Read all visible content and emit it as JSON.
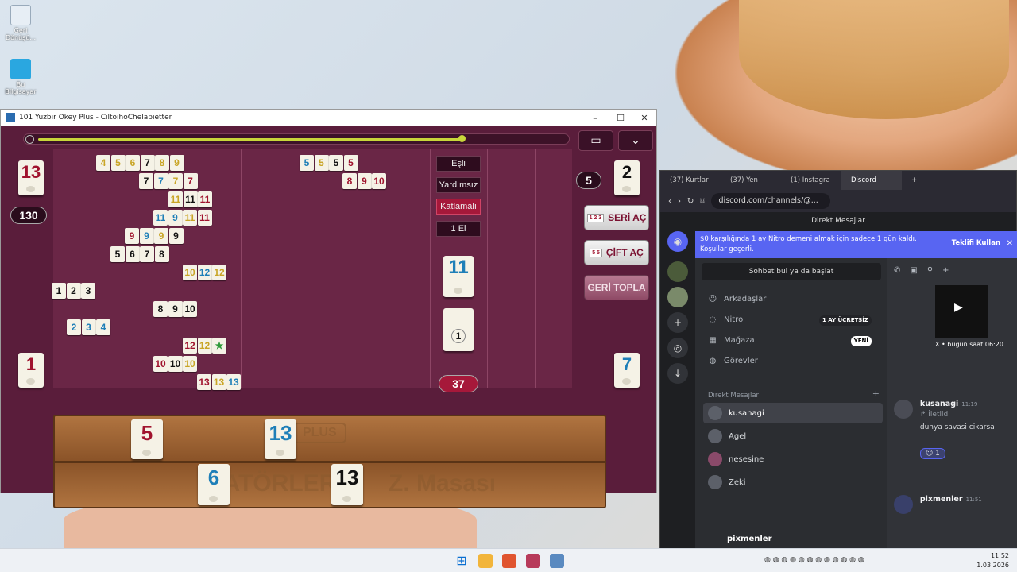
{
  "desktop": {
    "icons": [
      {
        "label": "Geri Dönüşü...",
        "icon": "recycle-bin-icon"
      },
      {
        "label": "Bu Bilgisayar",
        "icon": "computer-icon"
      }
    ]
  },
  "game_window": {
    "title": "101 Yüzbir Okey Plus - CiltoihoChelapietter",
    "controls": {
      "minimize": "–",
      "maximize": "☐",
      "close": "✕"
    },
    "timer_progress": 0.82,
    "chat_icon": "chat-bubble-icon",
    "menu_icon": "chevron-down-icon",
    "left_top_counter": "13",
    "left_score": "130",
    "left_bottom_counter": "1",
    "right_top_counter": "2",
    "right_badge": "5",
    "right_bottom_counter": "7",
    "options": [
      "Eşli",
      "Yardımsız",
      "Katlamalı",
      "1 El"
    ],
    "indicator_tile": "11",
    "deck_tile": "1",
    "deck_count": "37",
    "buttons": {
      "seri_label": "SERİ AÇ",
      "seri_mini": "1 2 3",
      "cift_label": "ÇİFT AÇ",
      "cift_mini": "5 5",
      "geri_label": "GERİ TOPLA"
    },
    "rack": {
      "watermark_left": "HATÖRLER -",
      "watermark_right": "Z. Masası",
      "logo": "PLUS",
      "top_tiles": [
        {
          "value": "5",
          "color": "red"
        },
        {
          "value": "13",
          "color": "blue"
        }
      ],
      "bottom_tiles": [
        {
          "value": "6",
          "color": "blue"
        },
        {
          "value": "13",
          "color": "black"
        }
      ]
    },
    "melds": [
      [
        "4",
        "5",
        "6",
        "7",
        "8",
        "9"
      ],
      [
        "7",
        "7",
        "7",
        "7"
      ],
      [
        "11",
        "11",
        "11"
      ],
      [
        "11",
        "9",
        "11",
        "11"
      ],
      [
        "9",
        "9",
        "9",
        "9"
      ],
      [
        "5",
        "6",
        "7",
        "8"
      ],
      [
        "10",
        "12",
        "12"
      ],
      [
        "1",
        "2",
        "3"
      ],
      [
        "8",
        "9",
        "10"
      ],
      [
        "2",
        "3",
        "4"
      ],
      [
        "12",
        "12",
        "★"
      ],
      [
        "10",
        "10",
        "10"
      ],
      [
        "13",
        "13",
        "13"
      ],
      [
        "5",
        "5",
        "5",
        "5"
      ],
      [
        "8",
        "9",
        "10"
      ]
    ]
  },
  "browser": {
    "tabs": [
      "(37) Kurtlar",
      "(37) Yen",
      "(1) Instagra",
      "Discord"
    ],
    "new_tab": "+",
    "url": "discord.com/channels/@...",
    "discord": {
      "header": "Direkt Mesajlar",
      "nitro_banner": "$0 karşılığında 1 ay Nitro demeni almak için sadece 1 gün kaldı. Koşullar geçerli.",
      "nitro_claim": "Teklifi Kullan",
      "search_placeholder": "Sohbet bul ya da başlat",
      "nav": [
        {
          "label": "Arkadaşlar",
          "icon": "friends-icon"
        },
        {
          "label": "Nitro",
          "icon": "nitro-icon",
          "pill": "1 AY ÜCRETSİZ"
        },
        {
          "label": "Mağaza",
          "icon": "shop-icon",
          "pill": "YENİ"
        },
        {
          "label": "Görevler",
          "icon": "quests-icon"
        }
      ],
      "dm_header": "Direkt Mesajlar",
      "dm_add": "+",
      "dms": [
        "kusanagi",
        "Agel",
        "nesesine",
        "Zeki"
      ],
      "footer_user": "pixmenler",
      "messages": [
        {
          "author": "kusanagi",
          "time": "11:19",
          "forwarded": "İletildi",
          "text": "dunya savasi cikarsa",
          "reaction_count": "1"
        },
        {
          "author": "pixmenler",
          "time": "11:51"
        }
      ],
      "embed": {
        "source": "X",
        "date": "bugün saat 06:20"
      }
    }
  },
  "taskbar": {
    "time": "11:52",
    "date": "1.03.2026"
  }
}
